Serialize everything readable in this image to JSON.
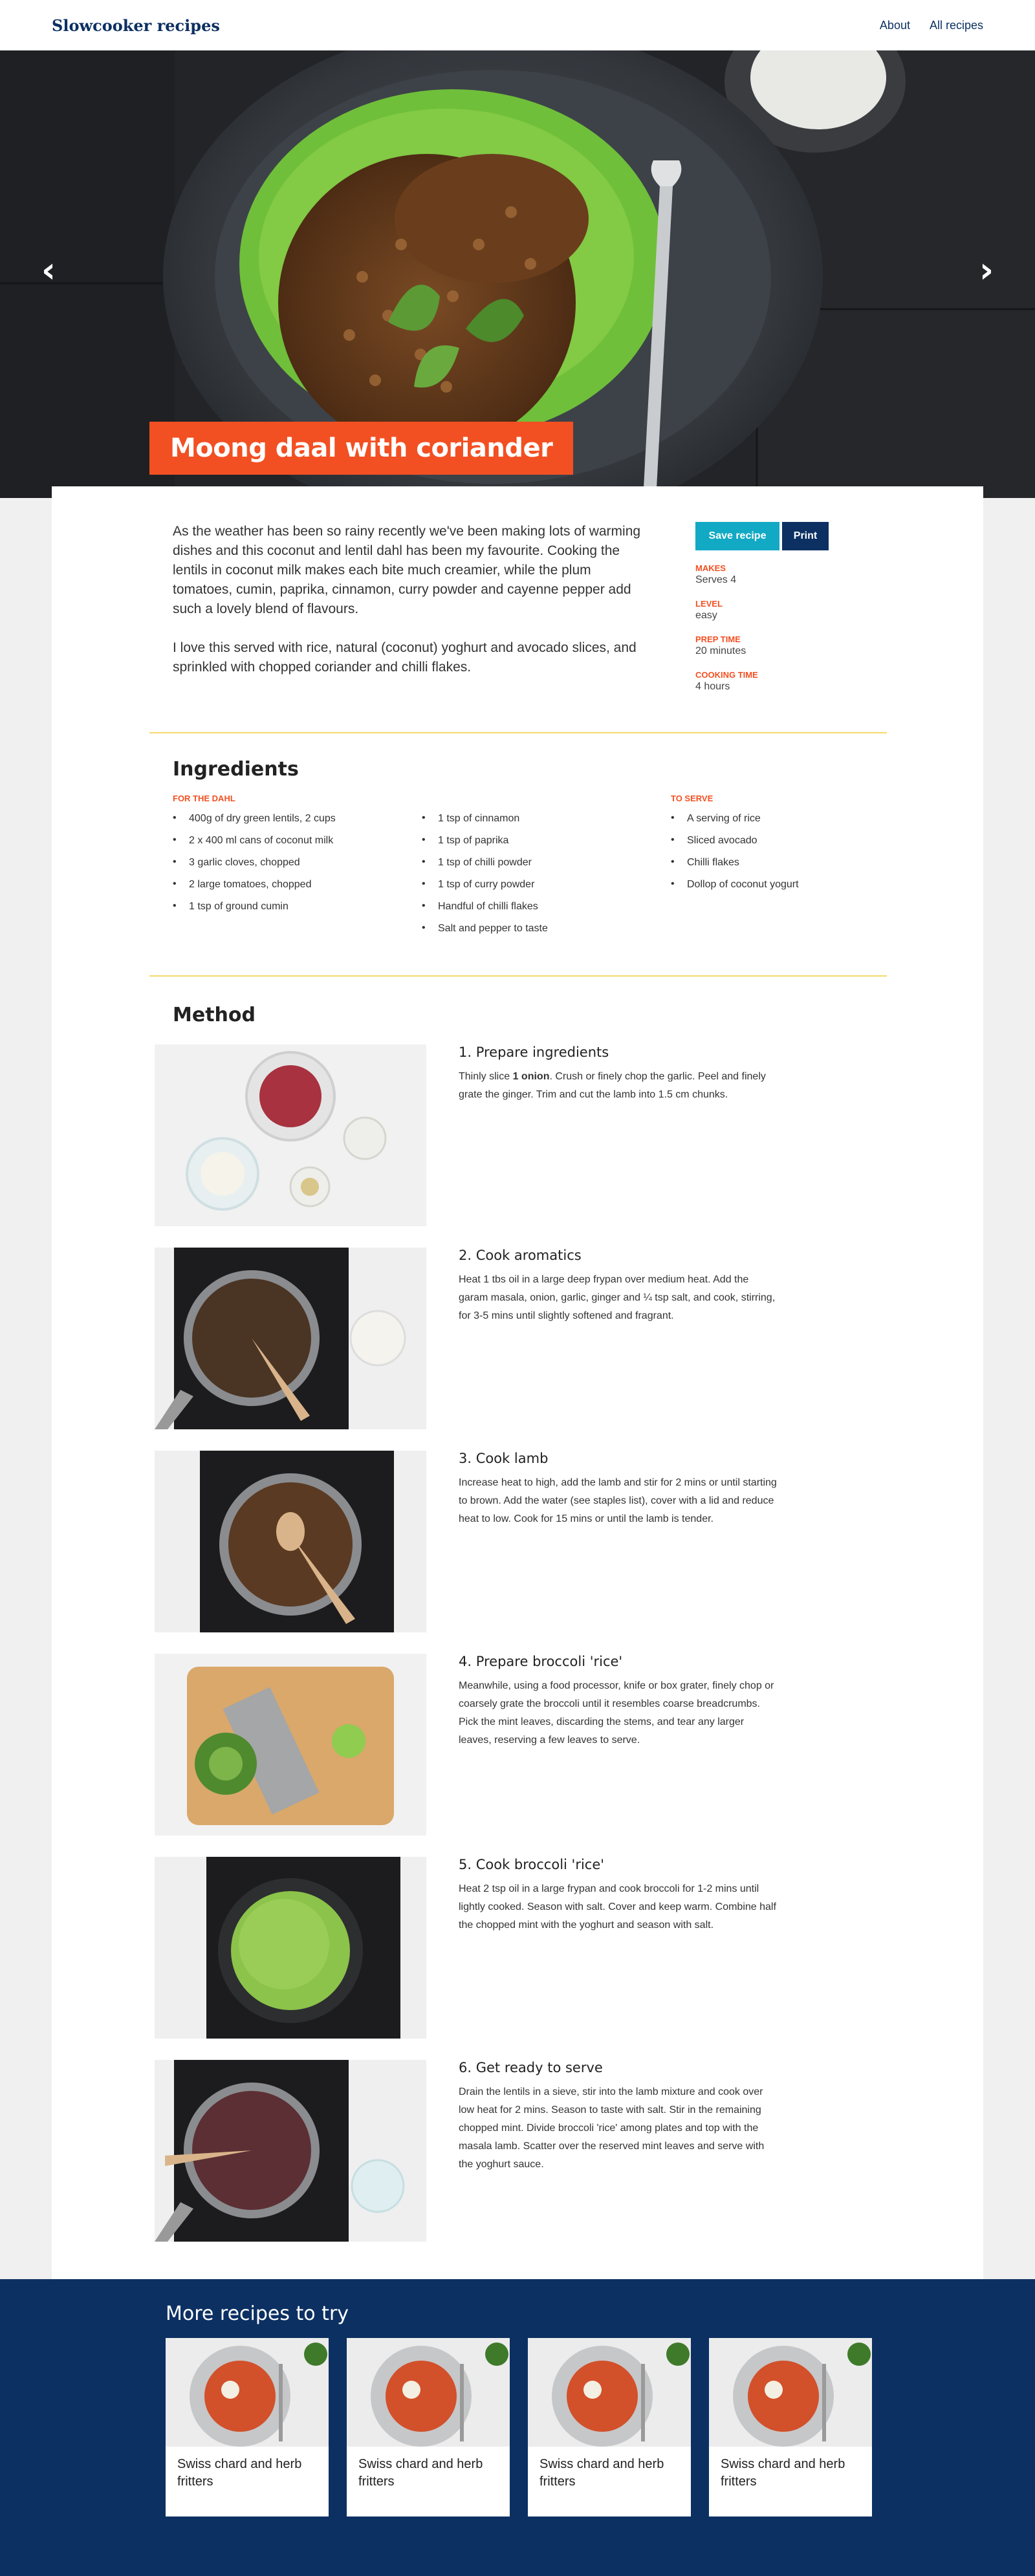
{
  "header": {
    "logo": "Slowcooker recipes",
    "nav": [
      "About",
      "All recipes"
    ]
  },
  "hero": {
    "prev_icon": "chevron-left-icon",
    "next_icon": "chevron-right-icon",
    "prev_glyph": "‹",
    "next_glyph": "›"
  },
  "recipe": {
    "title": "Moong daal with coriander",
    "intro": [
      "As the weather has been so rainy recently we've been making lots of warming dishes and this coconut and lentil dahl has been my favourite. Cooking the lentils in coconut milk makes each bite much creamier, while the plum tomatoes, cumin, paprika, cinnamon, curry powder and cayenne pepper add such a lovely blend of flavours.",
      "I love this served with rice, natural (coconut) yoghurt and avocado slices, and sprinkled with chopped coriander and chilli flakes."
    ],
    "buttons": {
      "save": "Save recipe",
      "print": "Print"
    },
    "meta": [
      {
        "label": "MAKES",
        "value": "Serves 4"
      },
      {
        "label": "LEVEL",
        "value": "easy"
      },
      {
        "label": "PREP TIME",
        "value": "20 minutes"
      },
      {
        "label": "COOKING TIME",
        "value": "4 hours"
      }
    ]
  },
  "ingredients": {
    "title": "Ingredients",
    "columns": [
      {
        "group": "FOR THE DAHL",
        "items": [
          "400g of dry green lentils, 2 cups",
          "2 x 400 ml cans of coconut milk",
          "3 garlic cloves, chopped",
          "2 large tomatoes, chopped",
          "1 tsp of ground cumin"
        ]
      },
      {
        "group": "",
        "items": [
          "1 tsp of cinnamon",
          "1 tsp of paprika",
          "1 tsp of chilli powder",
          "1 tsp of curry powder",
          "Handful of chilli flakes",
          "Salt and pepper to taste"
        ]
      },
      {
        "group": "TO SERVE",
        "items": [
          "A serving of rice",
          "Sliced avocado",
          "Chilli flakes",
          "Dollop of coconut yogurt"
        ]
      }
    ]
  },
  "method": {
    "title": "Method",
    "steps": [
      {
        "title": "1. Prepare ingredients",
        "pre": "Thinly slice ",
        "bold": "1 onion",
        "text": ". Crush or finely chop the garlic. Peel and finely grate the ginger. Trim and cut the lamb into 1.5 cm chunks."
      },
      {
        "title": "2. Cook aromatics",
        "pre": "",
        "bold": "",
        "text": "Heat 1 tbs oil in a large deep frypan over medium heat. Add the garam masala, onion, garlic, ginger and ¼ tsp salt, and cook, stirring, for 3-5 mins until slightly softened and fragrant."
      },
      {
        "title": "3. Cook lamb",
        "pre": "",
        "bold": "",
        "text": "Increase heat to high, add the lamb and stir for 2 mins or until starting to brown. Add the water (see staples list), cover with a lid and reduce heat to low. Cook for 15 mins or until the lamb is tender."
      },
      {
        "title": "4. Prepare broccoli 'rice'",
        "pre": "",
        "bold": "",
        "text": "Meanwhile, using a food processor, knife or box grater, finely chop or coarsely grate the broccoli until it resembles coarse breadcrumbs. Pick the mint leaves, discarding the stems, and tear any larger leaves, reserving a few leaves to serve."
      },
      {
        "title": "5. Cook broccoli 'rice'",
        "pre": "",
        "bold": "",
        "text": "Heat 2 tsp oil in a large frypan and cook broccoli for 1-2 mins until lightly cooked. Season with salt. Cover and keep warm. Combine half the chopped mint with the yoghurt and season with salt."
      },
      {
        "title": "6. Get ready to serve",
        "pre": "",
        "bold": "",
        "text": "Drain the lentils in a sieve, stir into the lamb mixture and cook over low heat for 2 mins. Season to taste with salt. Stir in the remaining chopped mint. Divide broccoli 'rice' among plates and top with the masala lamb. Scatter over the reserved mint leaves and serve with the yoghurt sauce."
      }
    ]
  },
  "more": {
    "title": "More recipes to try",
    "cards": [
      "Swiss chard and herb fritters",
      "Swiss chard and herb fritters",
      "Swiss chard and herb fritters",
      "Swiss chard and herb fritters"
    ]
  },
  "colors": {
    "accent": "#f25022",
    "navy": "#0c3062",
    "teal": "#12a9c4",
    "divider": "#f5d96b"
  }
}
